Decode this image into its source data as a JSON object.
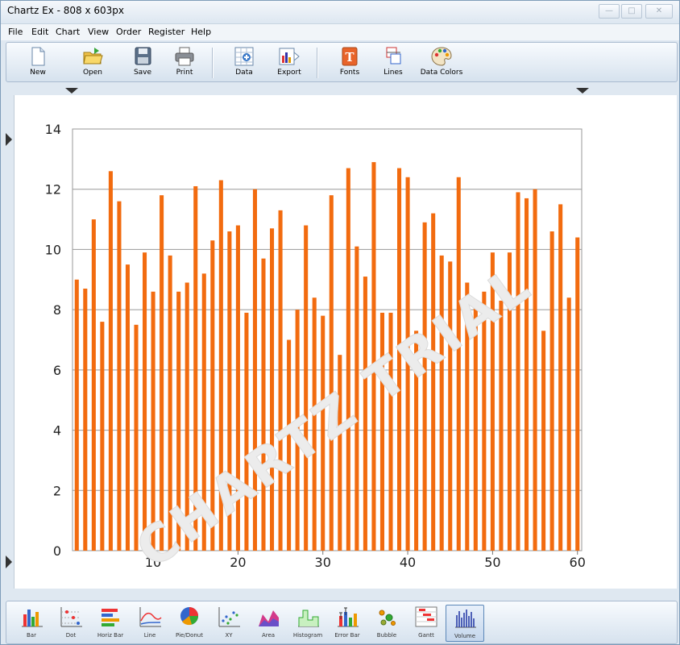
{
  "window": {
    "title": "Chartz Ex - 808 x 603px",
    "controls": [
      "minimize",
      "maximize",
      "close"
    ]
  },
  "menu": [
    "File",
    "Edit",
    "Chart",
    "View",
    "Order",
    "Register",
    "Help"
  ],
  "toolbar": [
    {
      "label": "New",
      "icon": "new-document-icon"
    },
    {
      "label": "Open",
      "icon": "open-folder-icon"
    },
    {
      "label": "Save",
      "icon": "save-disk-icon"
    },
    {
      "label": "Print",
      "icon": "printer-icon"
    },
    {
      "label": "Data",
      "icon": "data-icon"
    },
    {
      "label": "Export",
      "icon": "export-icon"
    },
    {
      "label": "Fonts",
      "icon": "fonts-icon"
    },
    {
      "label": "Lines",
      "icon": "lines-icon"
    },
    {
      "label": "Data Colors",
      "icon": "palette-icon"
    }
  ],
  "chart_types": [
    {
      "label": "Bar",
      "icon": "bar-chart-icon"
    },
    {
      "label": "Dot",
      "icon": "dot-chart-icon"
    },
    {
      "label": "Horiz Bar",
      "icon": "horiz-bar-chart-icon"
    },
    {
      "label": "Line",
      "icon": "line-chart-icon"
    },
    {
      "label": "Pie/Donut",
      "icon": "pie-chart-icon"
    },
    {
      "label": "XY",
      "icon": "xy-chart-icon"
    },
    {
      "label": "Area",
      "icon": "area-chart-icon"
    },
    {
      "label": "Histogram",
      "icon": "histogram-chart-icon"
    },
    {
      "label": "Error Bar",
      "icon": "error-bar-chart-icon"
    },
    {
      "label": "Bubble",
      "icon": "bubble-chart-icon"
    },
    {
      "label": "Gantt",
      "icon": "gantt-chart-icon"
    },
    {
      "label": "Volume",
      "icon": "volume-chart-icon",
      "selected": true
    }
  ],
  "watermark": "CHARTZ TRIAL",
  "colors": {
    "bar": "#f26b0f",
    "grid": "#999999",
    "watermark": "#e6e6e6"
  },
  "chart_data": {
    "type": "bar",
    "x": [
      1,
      2,
      3,
      4,
      5,
      6,
      7,
      8,
      9,
      10,
      11,
      12,
      13,
      14,
      15,
      16,
      17,
      18,
      19,
      20,
      21,
      22,
      23,
      24,
      25,
      26,
      27,
      28,
      29,
      30,
      31,
      32,
      33,
      34,
      35,
      36,
      37,
      38,
      39,
      40,
      41,
      42,
      43,
      44,
      45,
      46,
      47,
      48,
      49,
      50,
      51,
      52,
      53,
      54,
      55,
      56,
      57,
      58,
      59,
      60
    ],
    "values": [
      9.0,
      8.7,
      11.0,
      7.6,
      12.6,
      11.6,
      9.5,
      7.5,
      9.9,
      8.6,
      11.8,
      9.8,
      8.6,
      8.9,
      12.1,
      9.2,
      10.3,
      12.3,
      10.6,
      10.8,
      7.9,
      12.0,
      9.7,
      10.7,
      11.3,
      7.0,
      8.0,
      10.8,
      8.4,
      7.8,
      11.8,
      6.5,
      12.7,
      10.1,
      9.1,
      12.9,
      7.9,
      7.9,
      12.7,
      12.4,
      7.3,
      10.9,
      11.2,
      9.8,
      9.6,
      12.4,
      8.9,
      8.2,
      8.6,
      9.9,
      8.3,
      9.9,
      11.9,
      11.7,
      12.0,
      7.3,
      10.6,
      11.5,
      8.4,
      10.4
    ],
    "xticks": [
      10,
      20,
      30,
      40,
      50,
      60
    ],
    "yticks": [
      0,
      2,
      4,
      6,
      8,
      10,
      12,
      14
    ],
    "xlim": [
      0.5,
      60.5
    ],
    "ylim": [
      0,
      14
    ],
    "grid": true
  }
}
